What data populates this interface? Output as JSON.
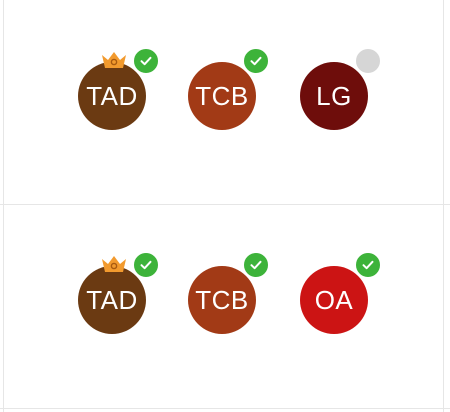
{
  "rows": [
    {
      "participants": [
        {
          "initials": "TAD",
          "color": "#6b3a12",
          "host": true,
          "status": "online",
          "status_icon": "check-icon"
        },
        {
          "initials": "TCB",
          "color": "#a23a16",
          "host": false,
          "status": "online",
          "status_icon": "check-icon"
        },
        {
          "initials": "LG",
          "color": "#6e0d0b",
          "host": false,
          "status": "offline",
          "status_icon": "none"
        }
      ]
    },
    {
      "participants": [
        {
          "initials": "TAD",
          "color": "#6b3a12",
          "host": true,
          "status": "online",
          "status_icon": "check-icon"
        },
        {
          "initials": "TCB",
          "color": "#a23a16",
          "host": false,
          "status": "online",
          "status_icon": "check-icon"
        },
        {
          "initials": "OA",
          "color": "#cc1414",
          "host": false,
          "status": "online",
          "status_icon": "check-icon"
        }
      ]
    }
  ],
  "colors": {
    "crown": "#f29a2e",
    "online": "#3db33a",
    "offline": "#d6d6d6",
    "grid": "#e6e6e6"
  }
}
